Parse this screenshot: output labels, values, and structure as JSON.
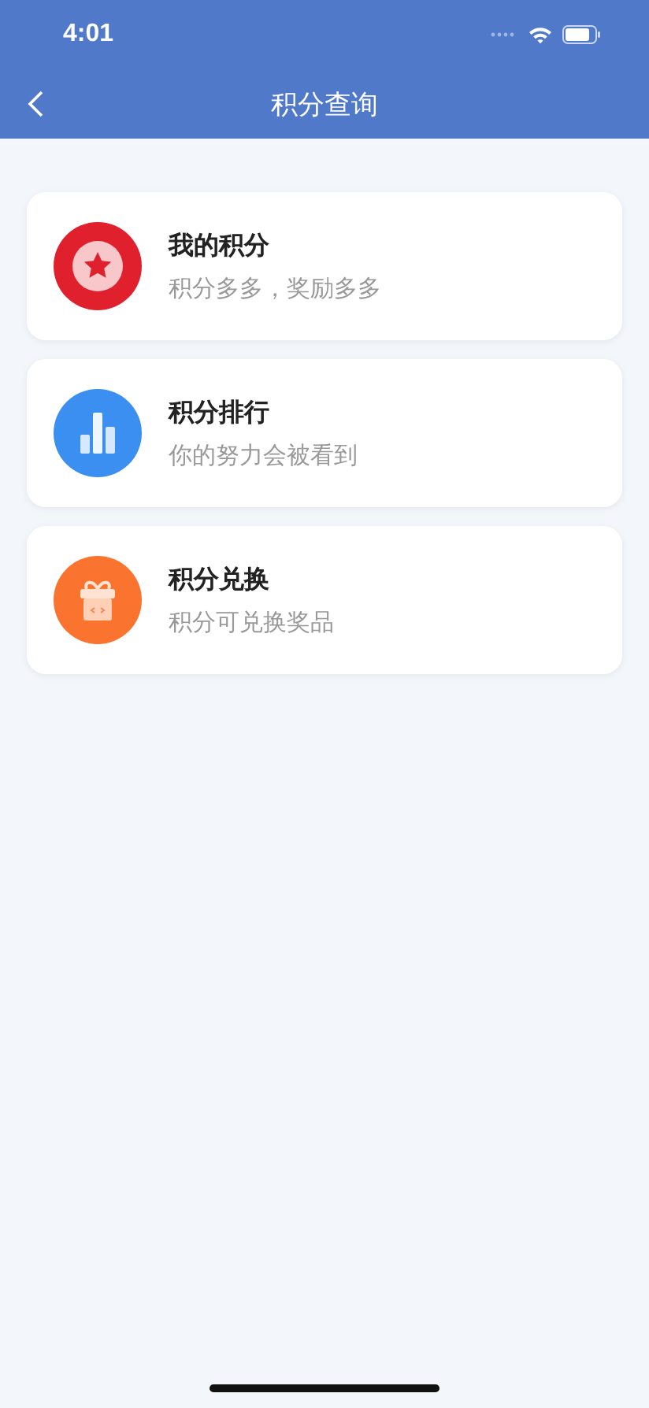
{
  "status_bar": {
    "time": "4:01"
  },
  "nav": {
    "title": "积分查询"
  },
  "menu": [
    {
      "kind": "star",
      "color": "#e0202c",
      "title": "我的积分",
      "subtitle": "积分多多，奖励多多"
    },
    {
      "kind": "bars",
      "color": "#3a8ff0",
      "title": "积分排行",
      "subtitle": "你的努力会被看到"
    },
    {
      "kind": "gift",
      "color": "#fa7430",
      "title": "积分兑换",
      "subtitle": "积分可兑换奖品"
    }
  ]
}
